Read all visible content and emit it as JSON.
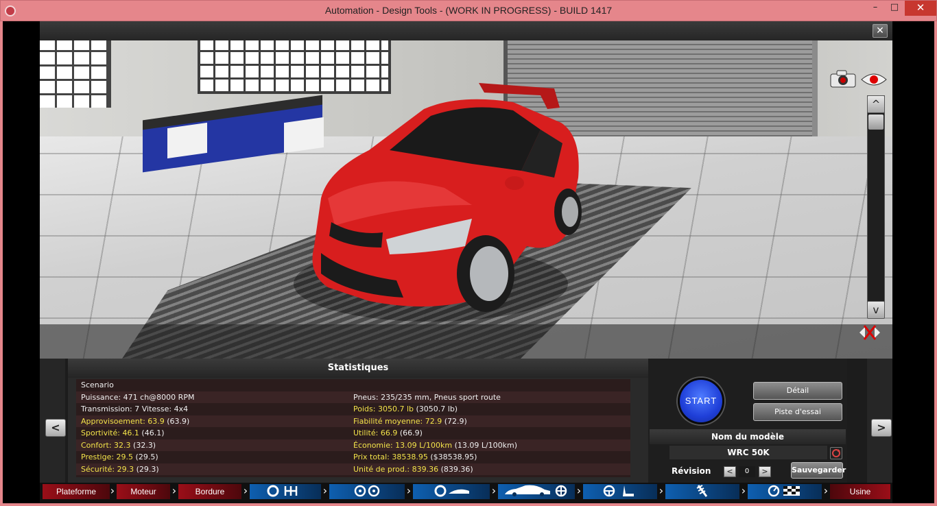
{
  "window": {
    "title": "Automation - Design Tools - (WORK IN PROGRESS) - BUILD 1417",
    "minimize": "–",
    "maximize": "□",
    "close": "✕"
  },
  "viewer": {
    "close_label": "✕",
    "scroll_up": "^",
    "scroll_down": "v"
  },
  "stats": {
    "title": "Statistiques",
    "left": [
      {
        "label": "Scenario",
        "value": "",
        "extra": ""
      },
      {
        "label": "Puissance: ",
        "value": "471 ch@8000 RPM",
        "extra": ""
      },
      {
        "label": "Transmission: ",
        "value": "7 Vitesse: 4x4",
        "extra": ""
      },
      {
        "label": "Approvisoement: ",
        "value": "63.9",
        "extra": " (63.9)"
      },
      {
        "label": "Sportivité: ",
        "value": "46.1",
        "extra": " (46.1)"
      },
      {
        "label": "Confort: ",
        "value": "32.3",
        "extra": " (32.3)"
      },
      {
        "label": "Prestige: ",
        "value": "29.5",
        "extra": " (29.5)"
      },
      {
        "label": "Sécurité: ",
        "value": "29.3",
        "extra": " (29.3)"
      }
    ],
    "right": [
      {
        "label": "",
        "value": "",
        "extra": ""
      },
      {
        "label": "Pneus: ",
        "value": "235/235 mm, Pneus sport route",
        "extra": ""
      },
      {
        "label": "Poids: ",
        "value": "3050.7 lb",
        "extra": " (3050.7 lb)"
      },
      {
        "label": "Fiabilité moyenne: ",
        "value": "72.9",
        "extra": " (72.9)"
      },
      {
        "label": "Utilité: ",
        "value": "66.9",
        "extra": " (66.9)"
      },
      {
        "label": "Économie: ",
        "value": "13.09 L/100km",
        "extra": " (13.09 L/100km)"
      },
      {
        "label": "Prix total: ",
        "value": "38538.95",
        "extra": " ($38538.95)"
      },
      {
        "label": "Unité de prod.: ",
        "value": "839.36",
        "extra": " (839.36)"
      }
    ]
  },
  "controls": {
    "start": "START",
    "detail": "Détail",
    "test_track": "Piste d'essai",
    "model_header": "Nom du modèle",
    "model_name": "WRC 50K",
    "revision_label": "Révision",
    "revision_value": "0",
    "rev_minus": "<",
    "rev_plus": ">",
    "save": "Sauvegarder",
    "prev": "<",
    "next": ">"
  },
  "tabs": {
    "plateforme": "Plateforme",
    "moteur": "Moteur",
    "bordure": "Bordure",
    "usine": "Usine",
    "chevron": "›"
  },
  "colors": {
    "accent_red": "#9a0e18",
    "accent_blue": "#0e5fb0",
    "stat_yellow": "#f3e34a",
    "car_red": "#d81e1e"
  }
}
